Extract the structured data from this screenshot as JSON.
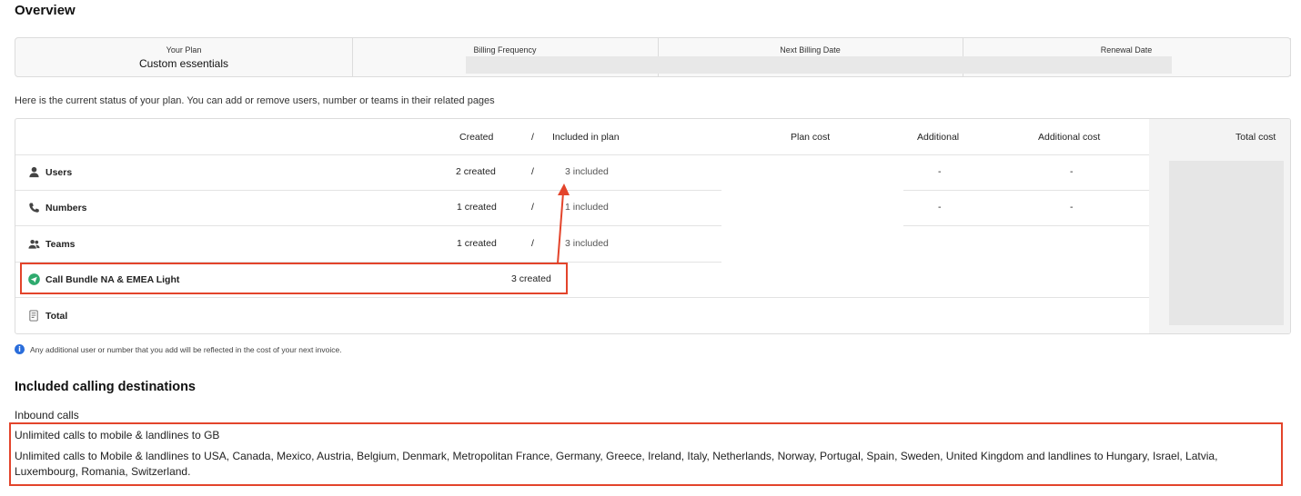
{
  "overview": {
    "title": "Overview"
  },
  "summary": {
    "your_plan_label": "Your Plan",
    "your_plan_value": "Custom essentials",
    "billing_frequency_label": "Billing Frequency",
    "next_billing_date_label": "Next Billing Date",
    "renewal_date_label": "Renewal Date"
  },
  "description": "Here is the current status of your plan. You can add or remove users, number or teams in their related pages",
  "table": {
    "headers": {
      "created": "Created",
      "slash": "/",
      "included": "Included in plan",
      "plan_cost": "Plan cost",
      "additional": "Additional",
      "additional_cost": "Additional cost",
      "total_cost": "Total cost"
    },
    "rows": [
      {
        "label": "Users",
        "icon": "user-icon",
        "created": "2 created",
        "slash": "/",
        "included": "3 included",
        "additional": "-",
        "additional_cost": "-"
      },
      {
        "label": "Numbers",
        "icon": "phone-icon",
        "created": "1 created",
        "slash": "/",
        "included": "1 included",
        "additional": "-",
        "additional_cost": "-"
      },
      {
        "label": "Teams",
        "icon": "team-icon",
        "created": "1 created",
        "slash": "/",
        "included": "3 included"
      },
      {
        "label": "Call Bundle NA & EMEA Light",
        "icon": "call-bundle-icon",
        "created": "3 created"
      },
      {
        "label": "Total",
        "icon": "invoice-icon"
      }
    ]
  },
  "note": "Any additional user or number that you add will be reflected in the cost of your next invoice.",
  "destinations": {
    "title": "Included calling destinations",
    "inbound_label": "Inbound calls",
    "lines": [
      "Unlimited calls to mobile & landlines to GB",
      "Unlimited calls to Mobile & landlines to USA, Canada, Mexico, Austria, Belgium, Denmark, Metropolitan France, Germany, Greece, Ireland, Italy, Netherlands, Norway, Portugal, Spain, Sweden, United Kingdom and landlines to Hungary, Israel, Latvia, Luxembourg, Romania, Switzerland."
    ]
  },
  "colors": {
    "highlight": "#e3442b",
    "info": "#2a6ddb",
    "bundle_icon": "#2eaa6e"
  }
}
